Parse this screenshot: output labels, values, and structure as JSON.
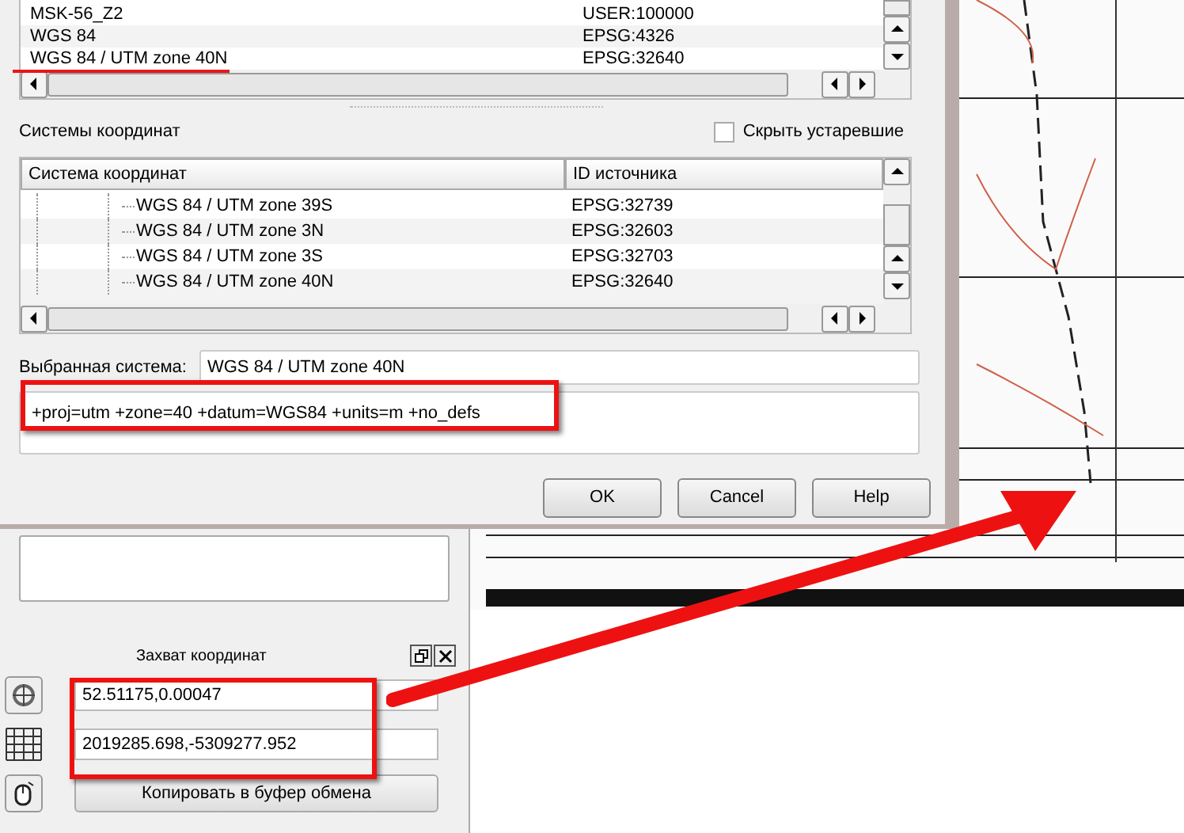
{
  "recent_crs": {
    "rows": [
      {
        "name": "MSK-56_Z2",
        "id": "USER:100000"
      },
      {
        "name": "WGS 84",
        "id": "EPSG:4326"
      },
      {
        "name": "WGS 84 / UTM zone 40N",
        "id": "EPSG:32640"
      }
    ]
  },
  "filter_label": "Системы координат",
  "hide_deprecated": {
    "label": "Скрыть устаревшие",
    "checked": false
  },
  "crs_tree": {
    "columns": [
      "Система координат",
      "ID источника"
    ],
    "rows": [
      {
        "name": "WGS 84 / UTM zone 39S",
        "id": "EPSG:32739"
      },
      {
        "name": "WGS 84 / UTM zone 3N",
        "id": "EPSG:32603"
      },
      {
        "name": "WGS 84 / UTM zone 3S",
        "id": "EPSG:32703"
      },
      {
        "name": "WGS 84 / UTM zone 40N",
        "id": "EPSG:32640"
      }
    ]
  },
  "selected_crs": {
    "label": "Выбранная система:",
    "value": "WGS 84 / UTM zone 40N"
  },
  "proj4": "+proj=utm +zone=40 +datum=WGS84 +units=m +no_defs",
  "buttons": [
    "OK",
    "Cancel",
    "Help"
  ],
  "coord_capture": {
    "title": "Захват координат",
    "fields": [
      "52.51175,0.00047",
      "2019285.698,-5309277.952"
    ],
    "copy_button": "Копировать в буфер обмена"
  }
}
